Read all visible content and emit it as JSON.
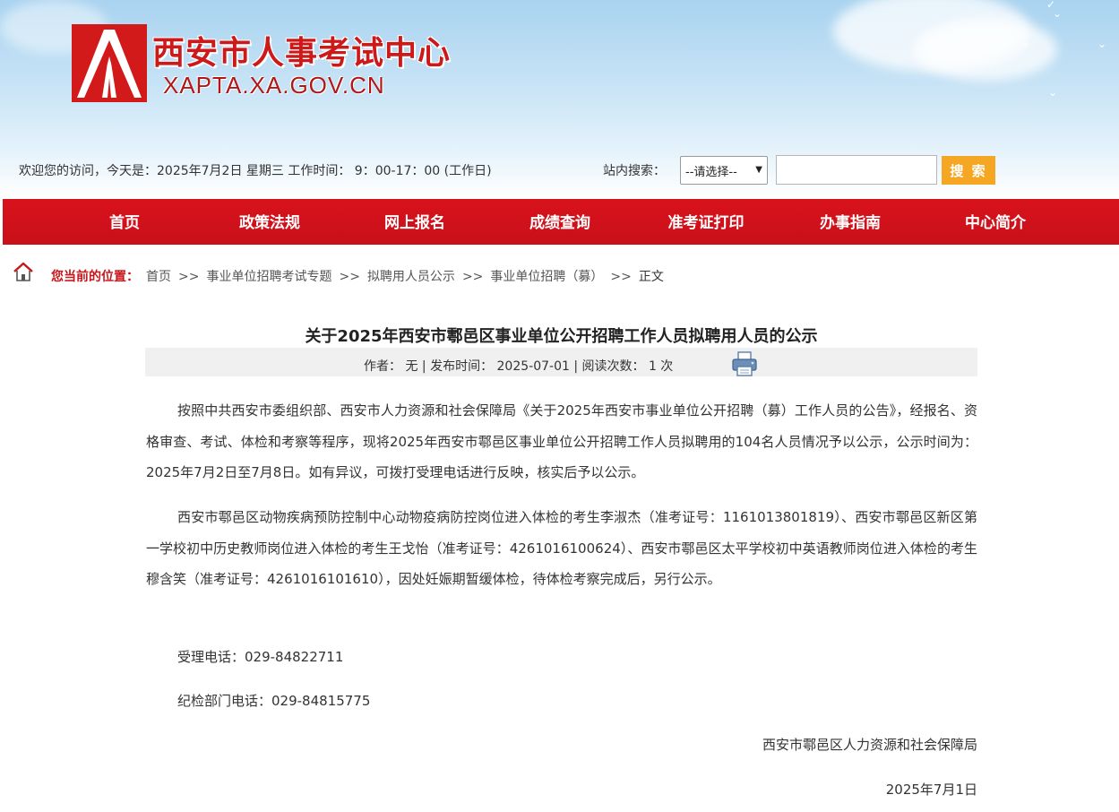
{
  "header": {
    "site_title": "西安市人事考试中心",
    "site_url": "XAPTA.XA.GOV.CN"
  },
  "infobar": {
    "welcome": "欢迎您的访问，今天是：2025年7月2日 星期三  工作时间： 9：00-17：00 (工作日)",
    "search_label": "站内搜索：",
    "search_select": "--请选择--",
    "search_value": "",
    "search_button": "搜 索"
  },
  "nav": {
    "items": [
      "首页",
      "政策法规",
      "网上报名",
      "成绩查询",
      "准考证打印",
      "办事指南",
      "中心简介"
    ]
  },
  "breadcrumb": {
    "label": "您当前的位置：",
    "items": [
      "首页",
      "事业单位招聘考试专题",
      "拟聘用人员公示",
      "事业单位招聘（募）",
      "正文"
    ],
    "separator": ">>"
  },
  "article": {
    "title": "关于2025年西安市鄠邑区事业单位公开招聘工作人员拟聘用人员的公示",
    "meta": "作者：  无  |  发布时间：  2025-07-01   |  阅读次数：  1 次",
    "paragraphs": [
      "按照中共西安市委组织部、西安市人力资源和社会保障局《关于2025年西安市事业单位公开招聘（募）工作人员的公告》，经报名、资格审查、考试、体检和考察等程序，现将2025年西安市鄠邑区事业单位公开招聘工作人员拟聘用的104名人员情况予以公示，公示时间为：2025年7月2日至7月8日。如有异议，可拨打受理电话进行反映，核实后予以公示。",
      "西安市鄠邑区动物疾病预防控制中心动物疫病防控岗位进入体检的考生李淑杰（准考证号：1161013801819）、西安市鄠邑区新区第一学校初中历史教师岗位进入体检的考生王戈怡（准考证号：4261016100624）、西安市鄠邑区太平学校初中英语教师岗位进入体检的考生穆含笑（准考证号：4261016101610），因处妊娠期暂缓体检，待体检考察完成后，另行公示。"
    ],
    "phone_line": "受理电话：029-84822711",
    "discipline_line": "纪检部门电话：029-84815775",
    "signature": "西安市鄠邑区人力资源和社会保障局",
    "date": "2025年7月1日"
  }
}
